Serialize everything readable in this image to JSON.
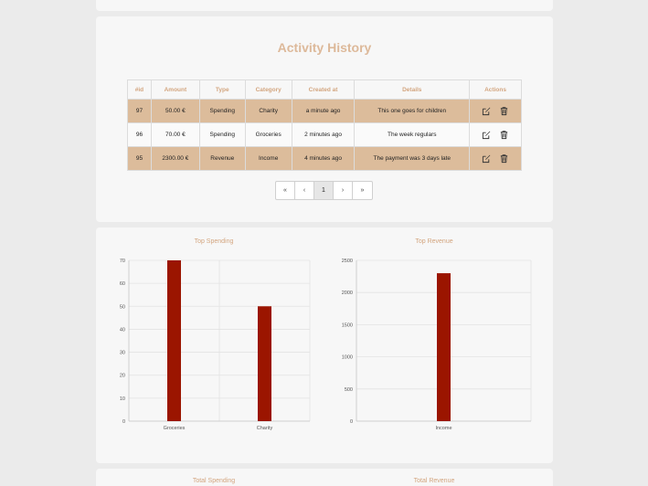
{
  "activity": {
    "title": "Activity History",
    "columns": [
      "#id",
      "Amount",
      "Type",
      "Category",
      "Created at",
      "Details",
      "Actions"
    ],
    "rows": [
      {
        "id": "97",
        "amount": "50.00 €",
        "type": "Spending",
        "category": "Charity",
        "created": "a minute ago",
        "details": "This one goes for children"
      },
      {
        "id": "96",
        "amount": "70.00 €",
        "type": "Spending",
        "category": "Groceries",
        "created": "2 minutes ago",
        "details": "The week regulars"
      },
      {
        "id": "95",
        "amount": "2300.00 €",
        "type": "Revenue",
        "category": "Income",
        "created": "4 minutes ago",
        "details": "The payment was 3 days late"
      }
    ],
    "pagination": {
      "first": "«",
      "prev": "‹",
      "current": "1",
      "next": "›",
      "last": "»"
    }
  },
  "colors": {
    "accent": "#d3a57f",
    "row_highlight": "#dcbc9b",
    "bar": "#9b1500"
  },
  "icons": {
    "edit": "edit-icon",
    "delete": "trash-icon"
  },
  "chart_data": [
    {
      "type": "bar",
      "title": "Top Spending",
      "categories": [
        "Groceries",
        "Charity"
      ],
      "values": [
        70,
        50
      ],
      "yticks": [
        0,
        10,
        20,
        30,
        40,
        50,
        60,
        70
      ],
      "ylim": [
        0,
        70
      ],
      "grid": true
    },
    {
      "type": "bar",
      "title": "Top Revenue",
      "categories": [
        "Income"
      ],
      "values": [
        2300
      ],
      "yticks": [
        0,
        500,
        1000,
        1500,
        2000,
        2500
      ],
      "ylim": [
        0,
        2500
      ],
      "grid": true
    }
  ],
  "bottom": {
    "left_title": "Total Spending",
    "right_title": "Total Revenue"
  }
}
